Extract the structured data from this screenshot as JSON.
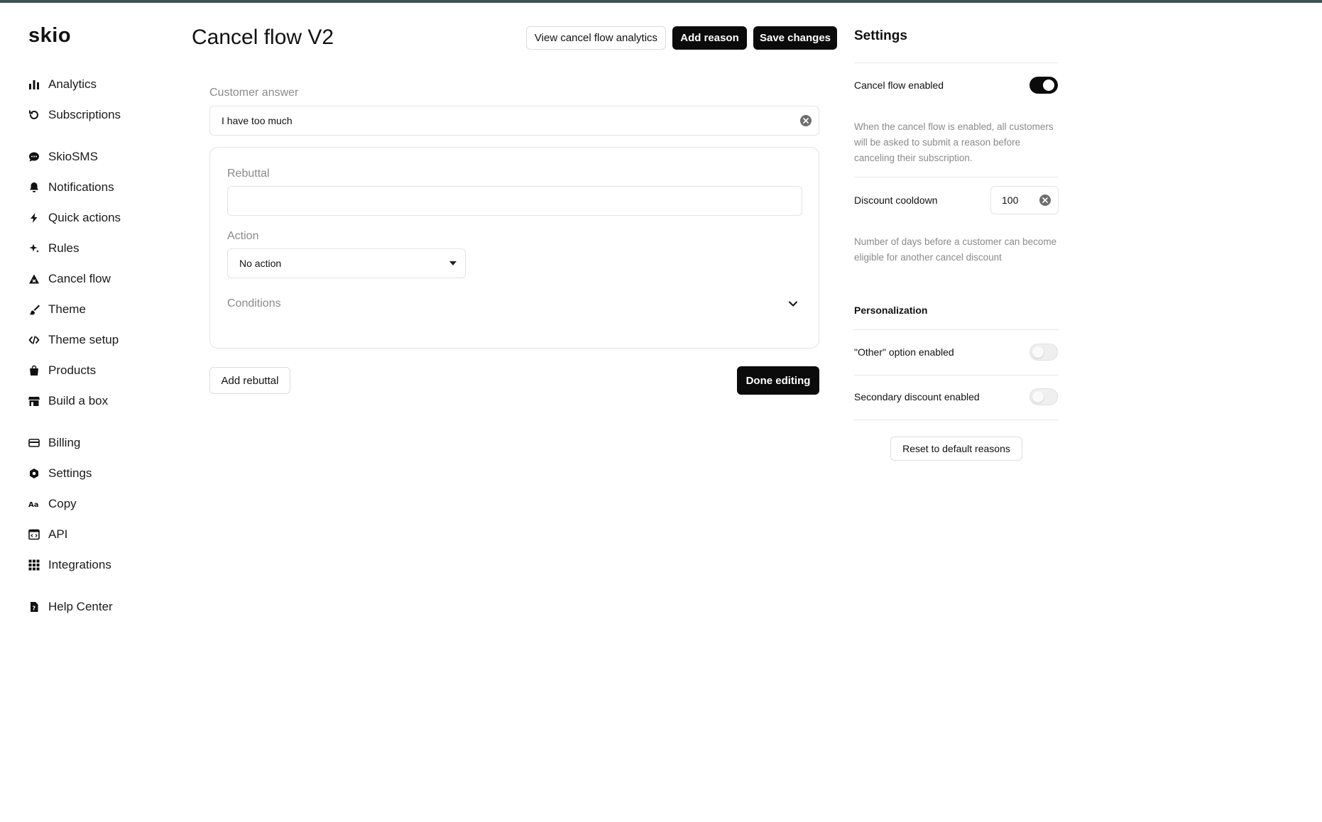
{
  "app": {
    "logo": "skio"
  },
  "sidebar": {
    "items": [
      {
        "label": "Analytics",
        "icon": "bar-chart-icon"
      },
      {
        "label": "Subscriptions",
        "icon": "refresh-icon"
      },
      {
        "label": "SkioSMS",
        "icon": "chat-bubble-icon"
      },
      {
        "label": "Notifications",
        "icon": "bell-icon"
      },
      {
        "label": "Quick actions",
        "icon": "lightning-icon"
      },
      {
        "label": "Rules",
        "icon": "sparkle-icon"
      },
      {
        "label": "Cancel flow",
        "icon": "warning-triangle-icon"
      },
      {
        "label": "Theme",
        "icon": "brush-icon"
      },
      {
        "label": "Theme setup",
        "icon": "code-icon"
      },
      {
        "label": "Products",
        "icon": "shopping-bag-icon"
      },
      {
        "label": "Build a box",
        "icon": "store-icon"
      },
      {
        "label": "Billing",
        "icon": "credit-card-icon"
      },
      {
        "label": "Settings",
        "icon": "gear-icon"
      },
      {
        "label": "Copy",
        "icon": "text-aa-icon"
      },
      {
        "label": "API",
        "icon": "api-window-icon"
      },
      {
        "label": "Integrations",
        "icon": "grid-icon"
      },
      {
        "label": "Help Center",
        "icon": "help-document-icon"
      }
    ]
  },
  "header": {
    "title": "Cancel flow V2",
    "view_analytics_label": "View cancel flow analytics",
    "add_reason_label": "Add reason",
    "save_changes_label": "Save changes"
  },
  "editor": {
    "customer_answer_label": "Customer answer",
    "customer_answer_value": "I have too much",
    "rebuttal_label": "Rebuttal",
    "rebuttal_value": "",
    "action_label": "Action",
    "action_value": "No action",
    "conditions_label": "Conditions",
    "add_rebuttal_label": "Add rebuttal",
    "done_editing_label": "Done editing"
  },
  "settings": {
    "title": "Settings",
    "cancel_flow_enabled_label": "Cancel flow enabled",
    "cancel_flow_enabled": true,
    "cancel_flow_desc": "When the cancel flow is enabled, all customers will be asked to submit a reason before canceling their subscription.",
    "discount_cooldown_label": "Discount cooldown",
    "discount_cooldown_value": "100",
    "discount_cooldown_desc": "Number of days before a customer can become eligible for another cancel discount",
    "personalization_label": "Personalization",
    "other_option_label": "\"Other\" option enabled",
    "other_option_enabled": false,
    "secondary_discount_label": "Secondary discount enabled",
    "secondary_discount_enabled": false,
    "reset_label": "Reset to default reasons"
  },
  "colors": {
    "accent": "#0b0b0b",
    "topbar": "#3f5258",
    "muted_text": "#8a8a8a",
    "border": "#e3e3e3"
  }
}
